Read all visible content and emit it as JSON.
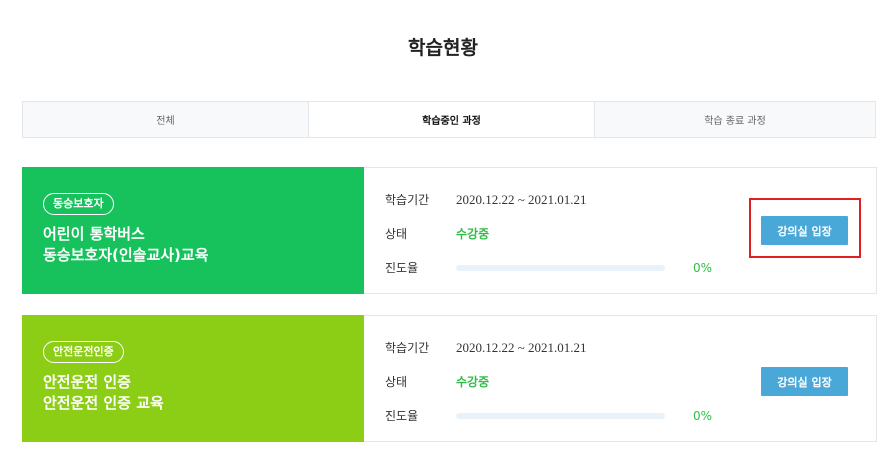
{
  "page_title": "학습현황",
  "tabs": [
    {
      "label": "전체",
      "active": false
    },
    {
      "label": "학습중인 과정",
      "active": true
    },
    {
      "label": "학습 종료 과정",
      "active": false
    }
  ],
  "info_labels": {
    "period": "학습기간",
    "status": "상태",
    "progress": "진도율"
  },
  "courses": [
    {
      "badge": "동승보호자",
      "title_line1": "어린이 통학버스",
      "title_line2": "동승보호자(인솔교사)교육",
      "panel_color": "#17c25d",
      "period": "2020.12.22 ~ 2021.01.21",
      "status": "수강중",
      "progress": 0,
      "progress_text": "0%",
      "enter_label": "강의실 입장"
    },
    {
      "badge": "안전운전인증",
      "title_line1": "안전운전 인증",
      "title_line2": "안전운전 인증 교육",
      "panel_color": "#8ccd16",
      "period": "2020.12.22 ~ 2021.01.21",
      "status": "수강중",
      "progress": 0,
      "progress_text": "0%",
      "enter_label": "강의실 입장"
    }
  ],
  "colors": {
    "status": "#2fbd47",
    "button": "#4aa8d8",
    "highlight": "#e02020"
  }
}
